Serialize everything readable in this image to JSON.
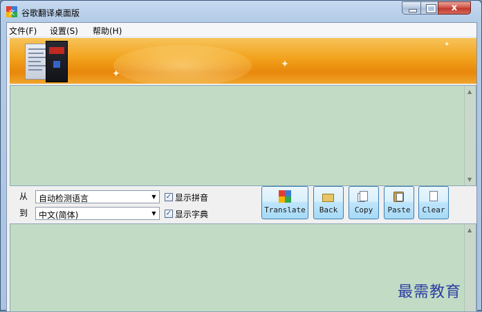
{
  "window": {
    "title": "谷歌翻译桌面版",
    "close_glyph": "x"
  },
  "menu": {
    "items": [
      "文件(F)",
      "设置(S)",
      "帮助(H)"
    ]
  },
  "from_label": "从",
  "to_label": "到",
  "source_lang": {
    "value": "自动检测语言"
  },
  "target_lang": {
    "value": "中文(简体)"
  },
  "options": {
    "show_pinyin": {
      "label": "显示拼音",
      "checked": true
    },
    "show_dict": {
      "label": "显示字典",
      "checked": true
    }
  },
  "buttons": {
    "translate": "Translate",
    "back": "Back",
    "copy": "Copy",
    "paste": "Paste",
    "clear": "Clear"
  },
  "watermark": "最需教育",
  "colors": {
    "text_area_bg": "#c2dbc5",
    "banner_orange": "#f2a21b",
    "button_blue": "#bee6fd"
  }
}
